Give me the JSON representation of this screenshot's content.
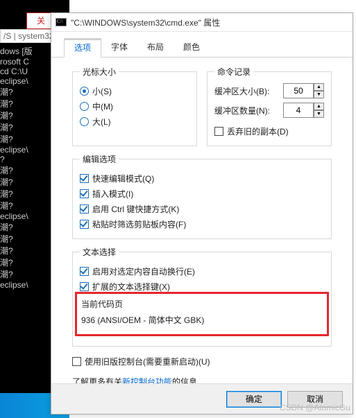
{
  "background": {
    "tab_label": "关",
    "address": "/S | system32",
    "cmd_lines": [
      "dows [版",
      "rosoft C",
      "",
      "cd C:\\U",
      "",
      "eclipse\\",
      "潮?",
      "潮?",
      "潮?",
      "潮?",
      "潮?",
      "",
      "eclipse\\",
      "?",
      "潮?",
      "潮?",
      "潮?",
      "潮?",
      "",
      "eclipse\\",
      "潮?",
      "潮?",
      "潮?",
      "潮?",
      "潮?",
      "",
      "eclipse\\"
    ]
  },
  "title": "\"C:\\WINDOWS\\system32\\cmd.exe\" 属性",
  "tabs": [
    {
      "label": "选项",
      "active": true
    },
    {
      "label": "字体",
      "active": false
    },
    {
      "label": "布局",
      "active": false
    },
    {
      "label": "颜色",
      "active": false
    }
  ],
  "cursor_group": {
    "legend": "光标大小",
    "items": [
      {
        "label": "小(S)",
        "checked": true
      },
      {
        "label": "中(M)",
        "checked": false
      },
      {
        "label": "大(L)",
        "checked": false
      }
    ]
  },
  "history_group": {
    "legend": "命令记录",
    "buffer_label": "缓冲区大小(B):",
    "buffer_value": "50",
    "count_label": "缓冲区数量(N):",
    "count_value": "4",
    "discard_label": "丢弃旧的副本(D)",
    "discard_checked": false
  },
  "edit_group": {
    "legend": "编辑选项",
    "items": [
      {
        "label": "快速编辑模式(Q)",
        "checked": true
      },
      {
        "label": "插入模式(I)",
        "checked": true
      },
      {
        "label": "启用 Ctrl 键快捷方式(K)",
        "checked": true
      },
      {
        "label": "粘贴时筛选剪贴板内容(F)",
        "checked": true
      }
    ]
  },
  "text_group": {
    "legend": "文本选择",
    "items": [
      {
        "label": "启用对选定内容自动换行(E)",
        "checked": true
      },
      {
        "label": "扩展的文本选择键(X)",
        "checked": true
      }
    ]
  },
  "codepage": {
    "title": "当前代码页",
    "line": "936  (ANSI/OEM - 简体中文 GBK)"
  },
  "legacy": {
    "label": "使用旧版控制台(需要重新启动)(U)",
    "checked": false,
    "info_prefix": "了解更多有关",
    "info_link": "新控制台功能",
    "info_suffix": "的信息"
  },
  "buttons": {
    "ok": "确定",
    "cancel": "取消"
  },
  "watermark": "CSDN @AtomicGu"
}
